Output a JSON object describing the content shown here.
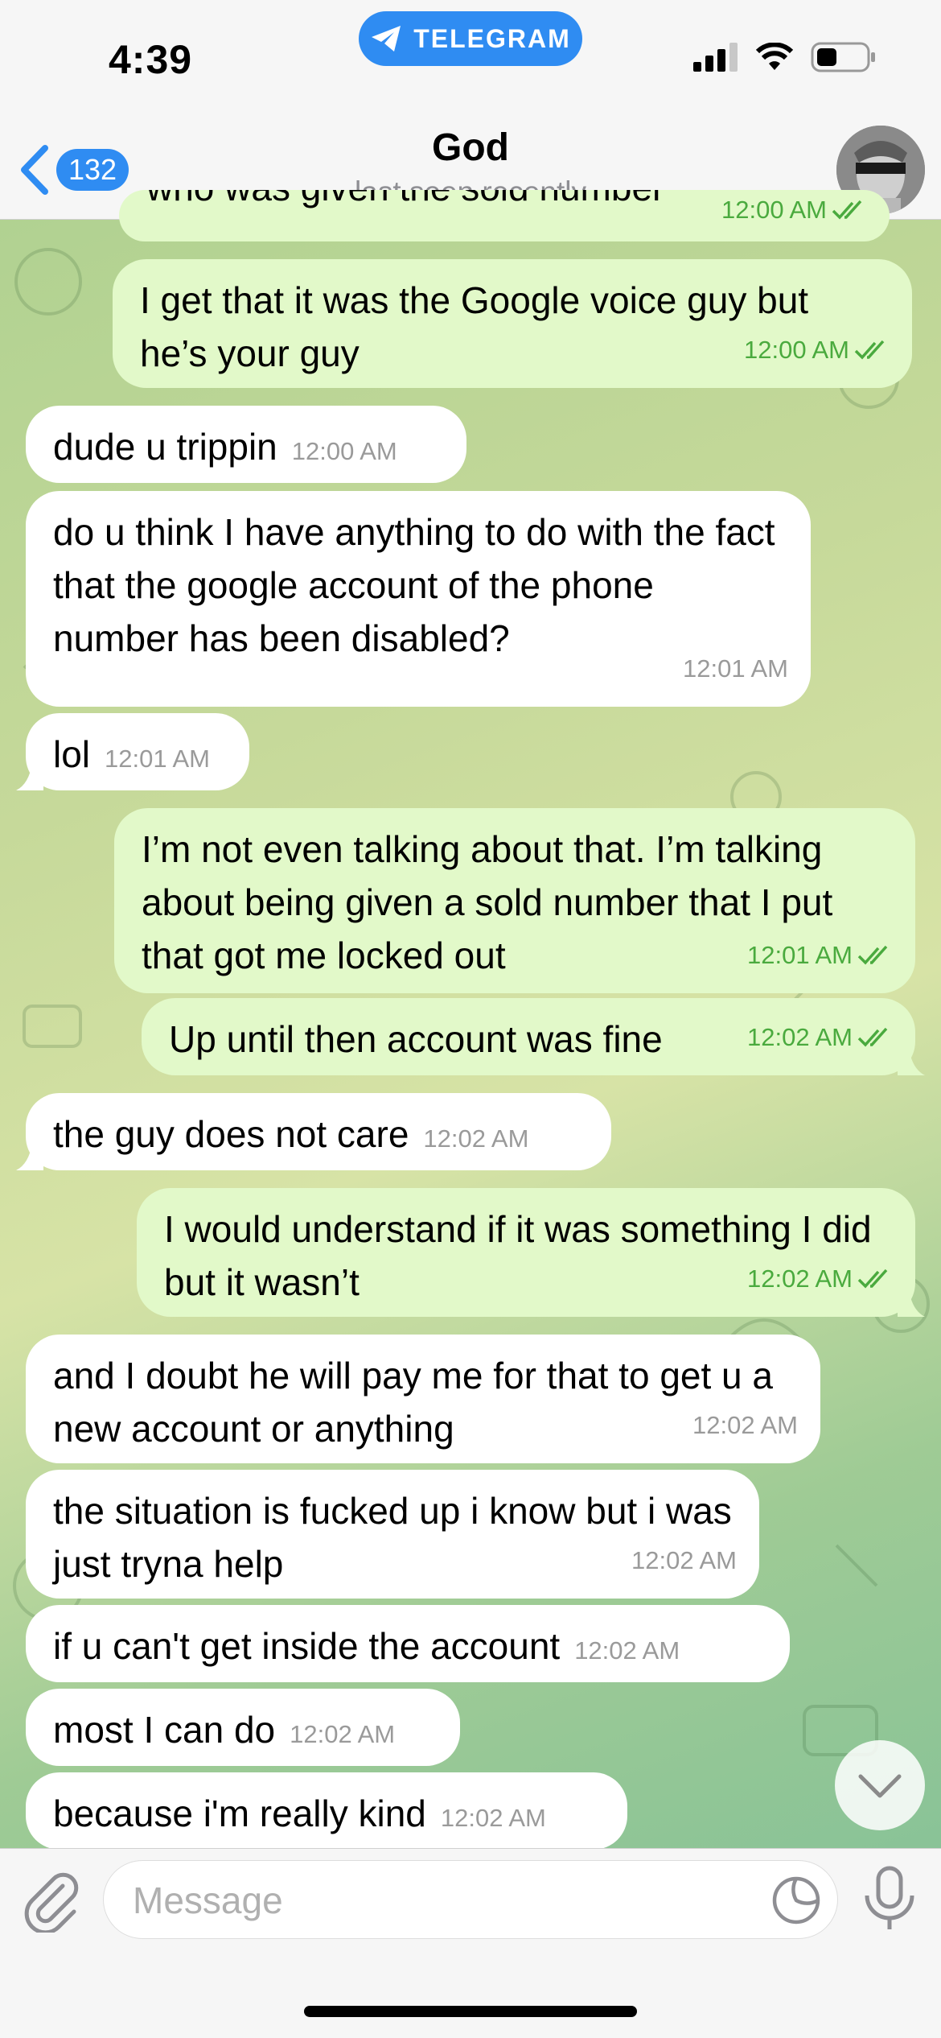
{
  "status_bar": {
    "time": "4:39",
    "app_badge": "TELEGRAM",
    "icons": [
      "signal-icon",
      "wifi-icon",
      "battery-icon"
    ]
  },
  "header": {
    "back_count": "132",
    "title": "God",
    "subtitle": "last seen recently"
  },
  "messages": [
    {
      "dir": "out",
      "text": "who was given the sold number",
      "time": "12:00 AM",
      "read": true
    },
    {
      "dir": "out",
      "text": "I get that it was the Google voice guy but he’s your guy",
      "time": "12:00 AM",
      "read": true
    },
    {
      "dir": "in",
      "text": "dude u trippin",
      "time": "12:00 AM"
    },
    {
      "dir": "in",
      "text": "do u think I have anything to do with the fact that the google account of the phone number has been disabled?",
      "time": "12:01 AM"
    },
    {
      "dir": "in",
      "text": "lol",
      "time": "12:01 AM"
    },
    {
      "dir": "out",
      "text": "I’m not even talking about that. I’m talking about being given a sold number that I put that got me locked out",
      "time": "12:01 AM",
      "read": true
    },
    {
      "dir": "out",
      "text": "Up until then account was fine",
      "time": "12:02 AM",
      "read": true
    },
    {
      "dir": "in",
      "text": "the guy does not care",
      "time": "12:02 AM"
    },
    {
      "dir": "out",
      "text": "I would understand if it was something I did but it wasn’t",
      "time": "12:02 AM",
      "read": true
    },
    {
      "dir": "in",
      "text": "and I doubt he will pay me for that to get u a new account or anything",
      "time": "12:02 AM"
    },
    {
      "dir": "in",
      "text": "the situation is fucked up i know but i was just tryna help",
      "time": "12:02 AM"
    },
    {
      "dir": "in",
      "text": "if u can't get inside the account",
      "time": "12:02 AM"
    },
    {
      "dir": "in",
      "text": "most I can do",
      "time": "12:02 AM"
    },
    {
      "dir": "in",
      "text": "because i'm really kind",
      "time": "12:02 AM"
    }
  ],
  "composer": {
    "placeholder": "Message"
  },
  "colors": {
    "accent": "#2f8cf2",
    "outgoing_bubble": "#e2f9c9",
    "incoming_bubble": "#ffffff",
    "read_check": "#4aaa3e"
  }
}
